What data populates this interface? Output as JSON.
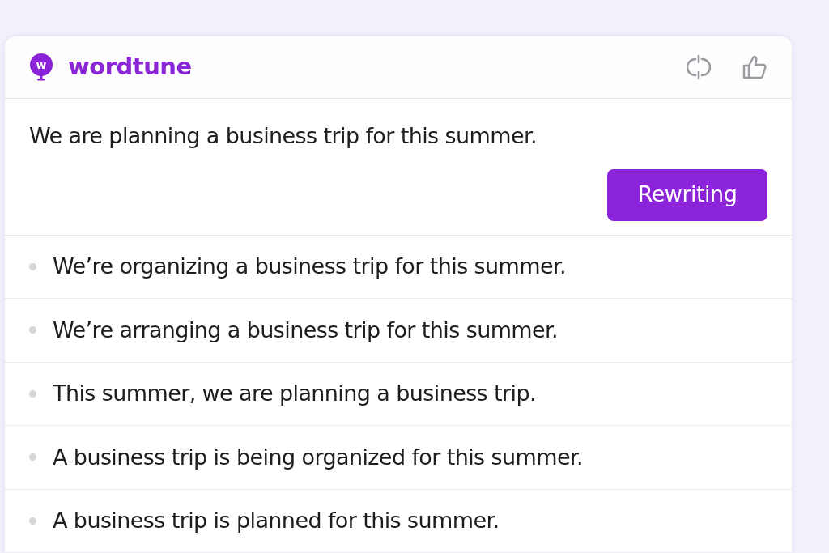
{
  "header": {
    "logo_letter": "w",
    "brand": "wordtune"
  },
  "input": {
    "text": "We are planning a business trip for this summer."
  },
  "button": {
    "label": "Rewriting"
  },
  "suggestions": [
    {
      "text": "We’re organizing a business trip for this summer."
    },
    {
      "text": "We’re arranging a business trip for this summer."
    },
    {
      "text": "This summer, we are planning a business trip."
    },
    {
      "text": "A business trip is being organized for this summer."
    },
    {
      "text": "A business trip is planned for this summer."
    }
  ]
}
